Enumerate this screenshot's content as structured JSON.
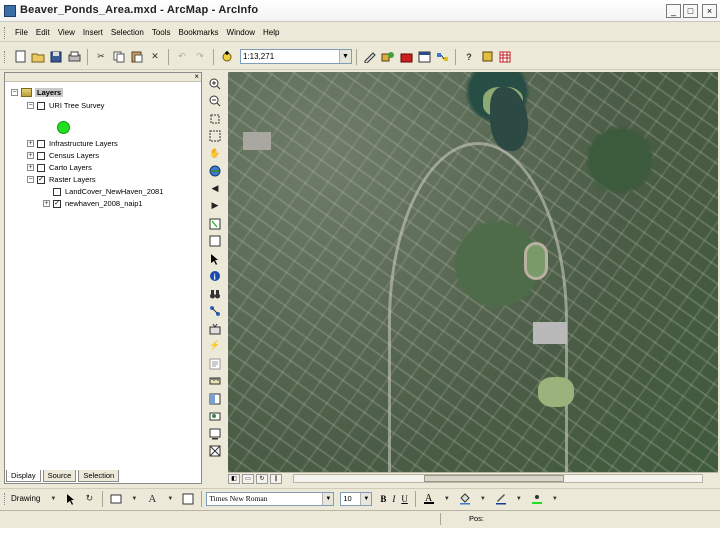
{
  "window": {
    "title": "Beaver_Ponds_Area.mxd - ArcMap - ArcInfo",
    "min": "_",
    "max": "□",
    "close": "×"
  },
  "menu": [
    "File",
    "Edit",
    "View",
    "Insert",
    "Selection",
    "Tools",
    "Bookmarks",
    "Window",
    "Help"
  ],
  "toolbar": {
    "scale_value": "1:13,271"
  },
  "toc": {
    "close": "×",
    "root_label": "Layers",
    "rows": [
      {
        "label": "URI Tree Survey",
        "expand": "−",
        "checked": false
      },
      {
        "label": "Infrastructure Layers",
        "expand": "+",
        "checked": false
      },
      {
        "label": "Census Layers",
        "expand": "+",
        "checked": false
      },
      {
        "label": "Carto Layers",
        "expand": "+",
        "checked": false
      },
      {
        "label": "Raster Layers",
        "expand": "−",
        "checked": true
      },
      {
        "label": "LandCover_NewHaven_2081",
        "expand": "",
        "checked": false
      },
      {
        "label": "newhaven_2008_naip1",
        "expand": "+",
        "checked": true
      }
    ],
    "symbol_color": "#22dd22",
    "tabs": [
      "Display",
      "Source",
      "Selection"
    ]
  },
  "drawing": {
    "label": "Drawing",
    "font_name": "Times New Roman",
    "font_size": "10",
    "bold": "B",
    "italic": "I",
    "underline": "U",
    "text_tool": "A"
  },
  "status": {
    "position_label": "Pos:"
  }
}
